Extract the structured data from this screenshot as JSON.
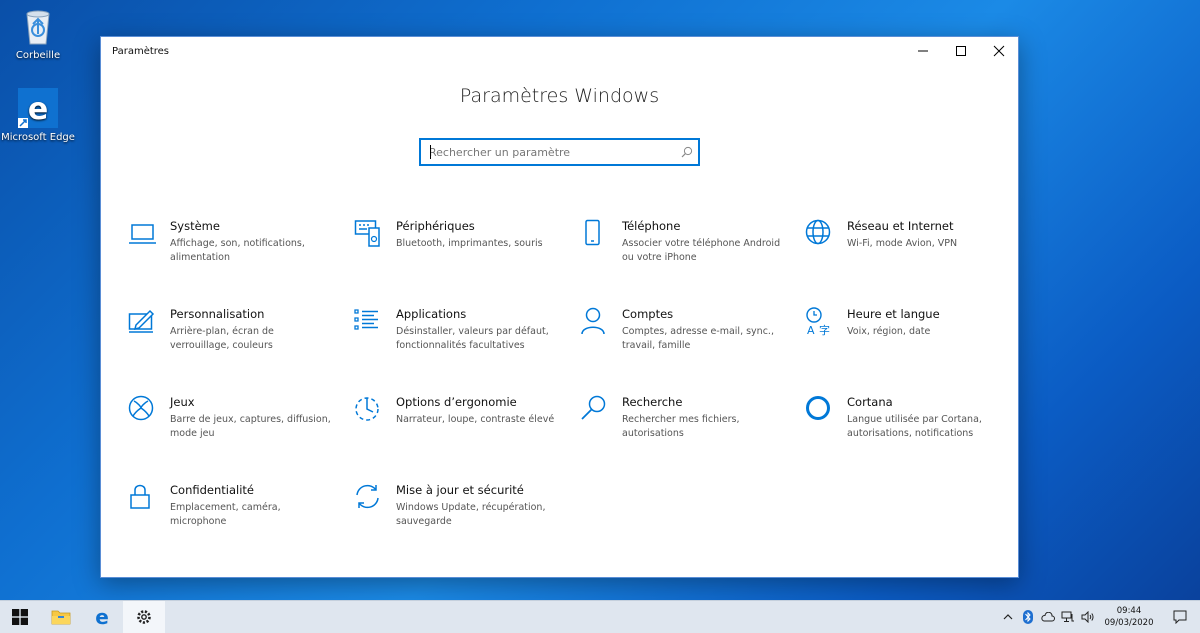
{
  "desktop": {
    "recycle_bin": "Corbeille",
    "edge": "Microsoft Edge"
  },
  "window": {
    "title": "Paramètres",
    "heading": "Paramètres Windows",
    "search_placeholder": "Rechercher un paramètre"
  },
  "items": [
    {
      "title": "Système",
      "desc": "Affichage, son, notifications, alimentation",
      "icon": "laptop-icon"
    },
    {
      "title": "Périphériques",
      "desc": "Bluetooth, imprimantes, souris",
      "icon": "devices-icon"
    },
    {
      "title": "Téléphone",
      "desc": "Associer votre téléphone Android ou votre iPhone",
      "icon": "phone-icon"
    },
    {
      "title": "Réseau et Internet",
      "desc": "Wi-Fi, mode Avion, VPN",
      "icon": "globe-icon"
    },
    {
      "title": "Personnalisation",
      "desc": "Arrière-plan, écran de verrouillage, couleurs",
      "icon": "personalization-icon"
    },
    {
      "title": "Applications",
      "desc": "Désinstaller, valeurs par défaut, fonctionnalités facultatives",
      "icon": "apps-list-icon"
    },
    {
      "title": "Comptes",
      "desc": "Comptes, adresse e-mail, sync., travail, famille",
      "icon": "person-icon"
    },
    {
      "title": "Heure et langue",
      "desc": "Voix, région, date",
      "icon": "time-language-icon"
    },
    {
      "title": "Jeux",
      "desc": "Barre de jeux, captures, diffusion, mode jeu",
      "icon": "xbox-icon"
    },
    {
      "title": "Options d’ergonomie",
      "desc": "Narrateur, loupe, contraste élevé",
      "icon": "ease-of-access-icon"
    },
    {
      "title": "Recherche",
      "desc": "Rechercher mes fichiers, autorisations",
      "icon": "search-icon"
    },
    {
      "title": "Cortana",
      "desc": "Langue utilisée par Cortana, autorisations, notifications",
      "icon": "cortana-icon"
    },
    {
      "title": "Confidentialité",
      "desc": "Emplacement, caméra, microphone",
      "icon": "lock-icon"
    },
    {
      "title": "Mise à jour et sécurité",
      "desc": "Windows Update, récupération, sauvegarde",
      "icon": "update-icon"
    }
  ],
  "taskbar": {
    "time": "09:44",
    "date": "09/03/2020"
  },
  "colors": {
    "accent": "#0078d7"
  }
}
